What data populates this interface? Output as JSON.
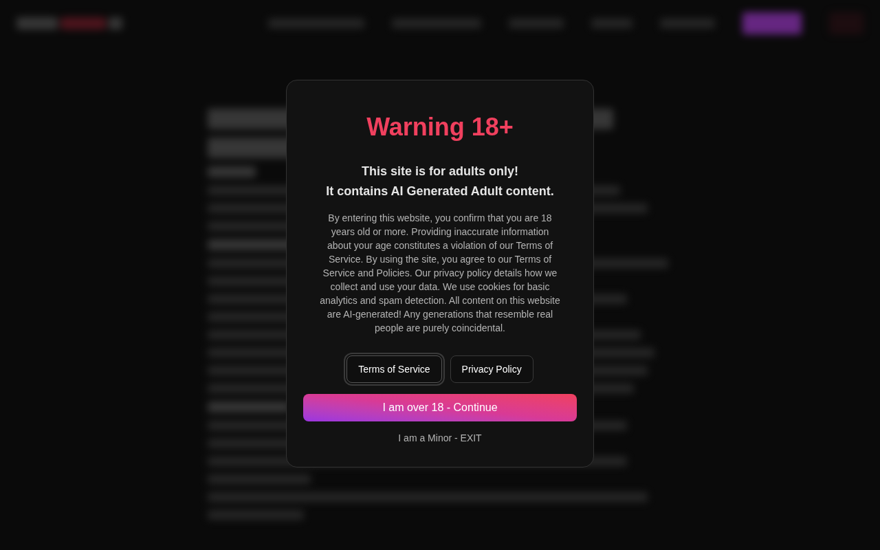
{
  "dialog": {
    "title": "Warning 18+",
    "headline": [
      "This site is for adults only!",
      "It contains AI Generated Adult content."
    ],
    "body": "By entering this website, you confirm that you are 18 years old or more. Providing inaccurate information about your age constitutes a violation of our Terms of Service. By using the site, you agree to our Terms of Service and Policies. Our privacy policy details how we collect and use your data. We use cookies for basic analytics and spam detection. All content on this website are AI-generated! Any generations that resemble real people are purely coincidental.",
    "links": [
      {
        "label": "Terms of Service",
        "focused": true
      },
      {
        "label": "Privacy Policy",
        "focused": false
      }
    ],
    "confirm": "I am over 18 - Continue",
    "exit": "I am a Minor - EXIT"
  }
}
